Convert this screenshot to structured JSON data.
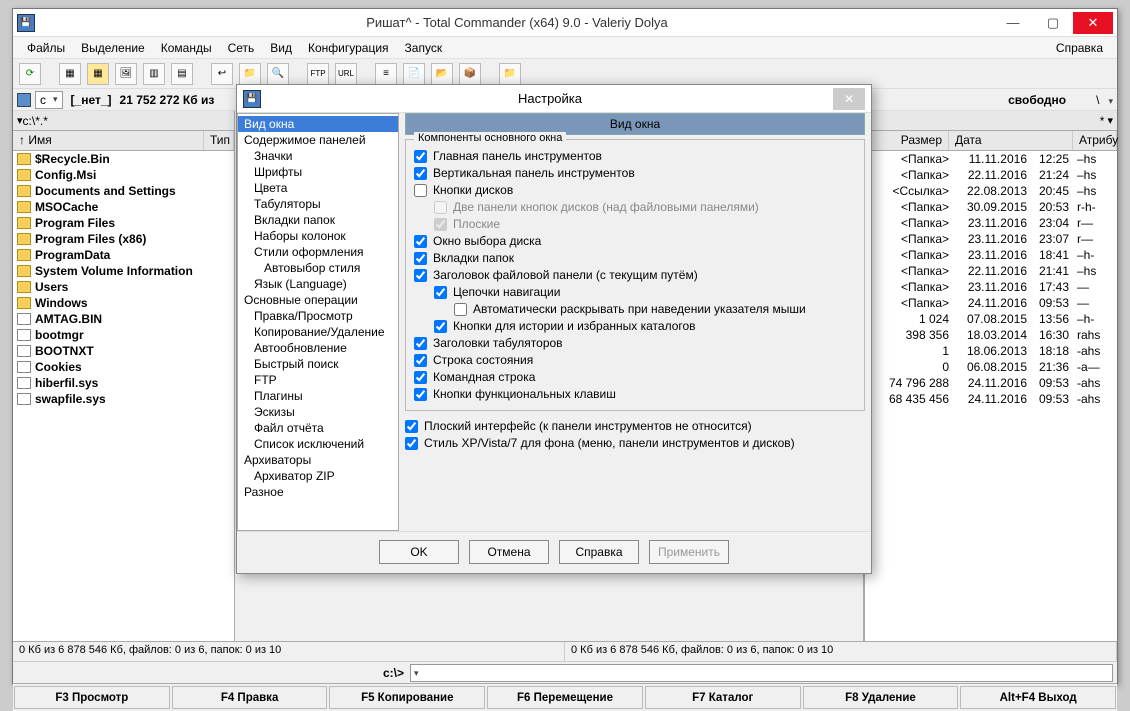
{
  "window": {
    "title": "Ришат^ - Total Commander (x64) 9.0 - Valeriy Dolya"
  },
  "menu": {
    "items": [
      "Файлы",
      "Выделение",
      "Команды",
      "Сеть",
      "Вид",
      "Конфигурация",
      "Запуск"
    ],
    "help": "Справка"
  },
  "driveinfo": {
    "left_drive": "c",
    "left_label": "[_нет_]",
    "left_free": "21 752 272 Кб из",
    "right_free": "свободно",
    "right_slash": "\\"
  },
  "tab": {
    "left": "c:\\*.*",
    "right": "*"
  },
  "columns": {
    "name": "Имя",
    "ext": "Тип",
    "size": "Размер",
    "date": "Дата",
    "attr": "Атрибу"
  },
  "left_files": [
    {
      "n": "$Recycle.Bin",
      "t": "folder"
    },
    {
      "n": "Config.Msi",
      "t": "folder"
    },
    {
      "n": "Documents and Settings",
      "t": "folder"
    },
    {
      "n": "MSOCache",
      "t": "folder"
    },
    {
      "n": "Program Files",
      "t": "folder"
    },
    {
      "n": "Program Files (x86)",
      "t": "folder"
    },
    {
      "n": "ProgramData",
      "t": "folder"
    },
    {
      "n": "System Volume Information",
      "t": "folder"
    },
    {
      "n": "Users",
      "t": "folder"
    },
    {
      "n": "Windows",
      "t": "folder"
    },
    {
      "n": "AMTAG.BIN",
      "t": "file"
    },
    {
      "n": "bootmgr",
      "t": "file"
    },
    {
      "n": "BOOTNXT",
      "t": "file"
    },
    {
      "n": "Cookies",
      "t": "file"
    },
    {
      "n": "hiberfil.sys",
      "t": "file"
    },
    {
      "n": "swapfile.sys",
      "t": "file"
    }
  ],
  "right_files": [
    {
      "size": "<Папка>",
      "date": "11.11.2016",
      "time": "12:25",
      "attr": "–hs"
    },
    {
      "size": "<Папка>",
      "date": "22.11.2016",
      "time": "21:24",
      "attr": "–hs"
    },
    {
      "size": "<Ссылка>",
      "date": "22.08.2013",
      "time": "20:45",
      "attr": "–hs"
    },
    {
      "size": "<Папка>",
      "date": "30.09.2015",
      "time": "20:53",
      "attr": "r-h-"
    },
    {
      "size": "<Папка>",
      "date": "23.11.2016",
      "time": "23:04",
      "attr": "r—"
    },
    {
      "size": "<Папка>",
      "date": "23.11.2016",
      "time": "23:07",
      "attr": "r—"
    },
    {
      "size": "<Папка>",
      "date": "23.11.2016",
      "time": "18:41",
      "attr": "–h-"
    },
    {
      "size": "<Папка>",
      "date": "22.11.2016",
      "time": "21:41",
      "attr": "–hs"
    },
    {
      "size": "<Папка>",
      "date": "23.11.2016",
      "time": "17:43",
      "attr": "—"
    },
    {
      "size": "<Папка>",
      "date": "24.11.2016",
      "time": "09:53",
      "attr": "—"
    },
    {
      "size": "1 024",
      "date": "07.08.2015",
      "time": "13:56",
      "attr": "–h-"
    },
    {
      "size": "398 356",
      "date": "18.03.2014",
      "time": "16:30",
      "attr": "rahs"
    },
    {
      "size": "1",
      "date": "18.06.2013",
      "time": "18:18",
      "attr": "-ahs"
    },
    {
      "size": "0",
      "date": "06.08.2015",
      "time": "21:36",
      "attr": "-a—"
    },
    {
      "size": "74 796 288",
      "date": "24.11.2016",
      "time": "09:53",
      "attr": "-ahs"
    },
    {
      "size": "68 435 456",
      "date": "24.11.2016",
      "time": "09:53",
      "attr": "-ahs"
    }
  ],
  "status": {
    "left": "0 Кб из 6 878 546 Кб, файлов: 0 из 6, папок: 0 из 10",
    "right": "0 Кб из 6 878 546 Кб, файлов: 0 из 6, папок: 0 из 10"
  },
  "cmd": {
    "prefix": "c:\\>"
  },
  "fkeys": [
    "F3 Просмотр",
    "F4 Правка",
    "F5 Копирование",
    "F6 Перемещение",
    "F7 Каталог",
    "F8 Удаление",
    "Alt+F4 Выход"
  ],
  "dialog": {
    "title": "Настройка",
    "page_title": "Вид окна",
    "ok": "OK",
    "cancel": "Отмена",
    "help": "Справка",
    "apply": "Применить",
    "tree": [
      {
        "l": "Вид окна",
        "sel": true
      },
      {
        "l": "Содержимое панелей"
      },
      {
        "l": "Значки",
        "c": 1
      },
      {
        "l": "Шрифты",
        "c": 1
      },
      {
        "l": "Цвета",
        "c": 1
      },
      {
        "l": "Табуляторы",
        "c": 1
      },
      {
        "l": "Вкладки папок",
        "c": 1
      },
      {
        "l": "Наборы колонок",
        "c": 1
      },
      {
        "l": "Стили оформления",
        "c": 1
      },
      {
        "l": "Автовыбор стиля",
        "c": 2
      },
      {
        "l": "Язык (Language)",
        "c": 1
      },
      {
        "l": "Основные операции"
      },
      {
        "l": "Правка/Просмотр",
        "c": 1
      },
      {
        "l": "Копирование/Удаление",
        "c": 1
      },
      {
        "l": "Автообновление",
        "c": 1
      },
      {
        "l": "Быстрый поиск",
        "c": 1
      },
      {
        "l": "FTP",
        "c": 1
      },
      {
        "l": "Плагины",
        "c": 1
      },
      {
        "l": "Эскизы",
        "c": 1
      },
      {
        "l": "Файл отчёта",
        "c": 1
      },
      {
        "l": "Список исключений",
        "c": 1
      },
      {
        "l": "Архиваторы"
      },
      {
        "l": "Архиватор ZIP",
        "c": 1
      },
      {
        "l": "Разное"
      }
    ],
    "group1_label": "Компоненты основного окна",
    "options": [
      {
        "k": "o1",
        "l": "Главная панель инструментов",
        "v": true
      },
      {
        "k": "o2",
        "l": "Вертикальная панель инструментов",
        "v": true
      },
      {
        "k": "o3",
        "l": "Кнопки дисков",
        "v": false
      },
      {
        "k": "o3a",
        "l": "Две панели кнопок дисков (над файловыми панелями)",
        "v": false,
        "i": 1,
        "d": true
      },
      {
        "k": "o3b",
        "l": "Плоские",
        "v": true,
        "i": 1,
        "d": true
      },
      {
        "k": "o4",
        "l": "Окно выбора диска",
        "v": true
      },
      {
        "k": "o5",
        "l": "Вкладки папок",
        "v": true
      },
      {
        "k": "o6",
        "l": "Заголовок файловой панели (с текущим путём)",
        "v": true
      },
      {
        "k": "o6a",
        "l": "Цепочки навигации",
        "v": true,
        "i": 1
      },
      {
        "k": "o6b",
        "l": "Автоматически раскрывать при наведении указателя мыши",
        "v": false,
        "i": 2
      },
      {
        "k": "o6c",
        "l": "Кнопки для истории и избранных каталогов",
        "v": true,
        "i": 1
      },
      {
        "k": "o7",
        "l": "Заголовки табуляторов",
        "v": true
      },
      {
        "k": "o8",
        "l": "Строка состояния",
        "v": true
      },
      {
        "k": "o9",
        "l": "Командная строка",
        "v": true
      },
      {
        "k": "o10",
        "l": "Кнопки функциональных клавиш",
        "v": true
      }
    ],
    "extra": [
      {
        "k": "e1",
        "l": "Плоский интерфейс (к панели инструментов не относится)",
        "v": true
      },
      {
        "k": "e2",
        "l": "Стиль XP/Vista/7 для фона (меню, панели инструментов и дисков)",
        "v": true
      }
    ]
  }
}
